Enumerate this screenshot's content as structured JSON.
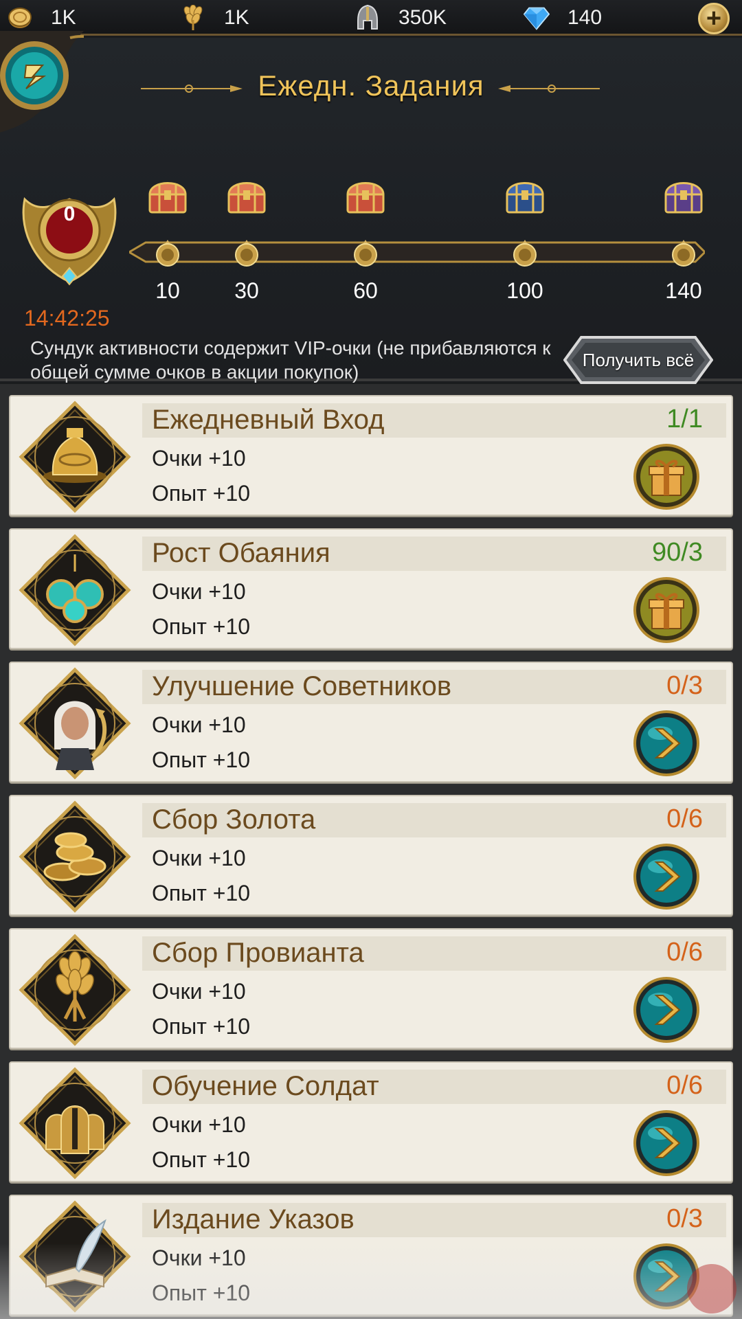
{
  "resources": [
    {
      "name": "gold",
      "icon": "gold-coin-icon",
      "value": "1K"
    },
    {
      "name": "food",
      "icon": "wheat-icon",
      "value": "1K"
    },
    {
      "name": "troops",
      "icon": "helmet-icon",
      "value": "350K"
    },
    {
      "name": "gems",
      "icon": "diamond-icon",
      "value": "140"
    }
  ],
  "header": {
    "title": "Ежедн. Задания",
    "points": "0",
    "timer": "14:42:25",
    "description": "Сундук активности содержит VIP-очки (не прибавляются к общей сумме очков в акции покупок)",
    "claim_all_label": "Получить всё"
  },
  "milestones": [
    {
      "value": "10",
      "chest": "red"
    },
    {
      "value": "30",
      "chest": "red"
    },
    {
      "value": "60",
      "chest": "red"
    },
    {
      "value": "100",
      "chest": "blue"
    },
    {
      "value": "140",
      "chest": "purple"
    }
  ],
  "progress_fraction": 0,
  "colors": {
    "accent_gold": "#f0c45a",
    "timer_orange": "#e2681f",
    "done_green": "#3f8a23",
    "todo_orange": "#d4621a"
  },
  "tasks": [
    {
      "name": "Ежедневный Вход",
      "progress": "1/1",
      "status": "done",
      "points": "Очки +10",
      "exp": "Опыт +10",
      "icon": "golden-urn-icon",
      "action": "gift"
    },
    {
      "name": "Рост Обаяния",
      "progress": "90/3",
      "status": "done",
      "points": "Очки +10",
      "exp": "Опыт +10",
      "icon": "jewel-earrings-icon",
      "action": "gift"
    },
    {
      "name": "Улучшение Советников",
      "progress": "0/3",
      "status": "todo",
      "points": "Очки +10",
      "exp": "Опыт +10",
      "icon": "advisor-portrait-icon",
      "action": "go"
    },
    {
      "name": "Сбор Золота",
      "progress": "0/6",
      "status": "todo",
      "points": "Очки +10",
      "exp": "Опыт +10",
      "icon": "gold-coins-icon",
      "action": "go"
    },
    {
      "name": "Сбор Провианта",
      "progress": "0/6",
      "status": "todo",
      "points": "Очки +10",
      "exp": "Опыт +10",
      "icon": "wheat-sheaf-icon",
      "action": "go"
    },
    {
      "name": "Обучение Солдат",
      "progress": "0/6",
      "status": "todo",
      "points": "Очки +10",
      "exp": "Опыт +10",
      "icon": "soldier-helmets-icon",
      "action": "go"
    },
    {
      "name": "Издание Указов",
      "progress": "0/3",
      "status": "todo",
      "points": "Очки +10",
      "exp": "Опыт +10",
      "icon": "quill-book-icon",
      "action": "go"
    }
  ]
}
